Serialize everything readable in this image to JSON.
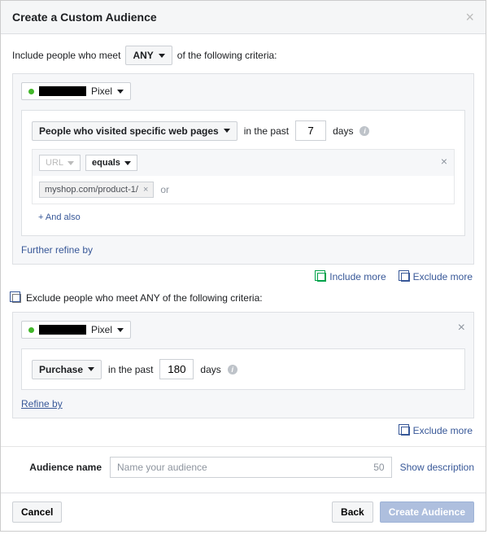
{
  "title": "Create a Custom Audience",
  "include": {
    "prefix": "Include people who meet",
    "mode": "ANY",
    "suffix": "of the following criteria:"
  },
  "source1": {
    "pixel_suffix": "Pixel",
    "rule": {
      "event": "People who visited specific web pages",
      "past_prefix": "in the past",
      "days_value": "7",
      "days_label": "days",
      "url_label": "URL",
      "operator": "equals",
      "token": "myshop.com/product-1/",
      "or": "or",
      "and_also": "+ And also"
    },
    "refine": "Further refine by"
  },
  "actions": {
    "include_more": "Include more",
    "exclude_more": "Exclude more"
  },
  "exclude": {
    "header": "Exclude people who meet ANY of the following criteria:"
  },
  "source2": {
    "pixel_suffix": "Pixel",
    "rule": {
      "event": "Purchase",
      "past_prefix": "in the past",
      "days_value": "180",
      "days_label": "days"
    },
    "refine": "Refine by"
  },
  "name": {
    "label": "Audience name",
    "placeholder": "Name your audience",
    "remaining": "50",
    "show_desc": "Show description"
  },
  "footer": {
    "cancel": "Cancel",
    "back": "Back",
    "create": "Create Audience"
  }
}
